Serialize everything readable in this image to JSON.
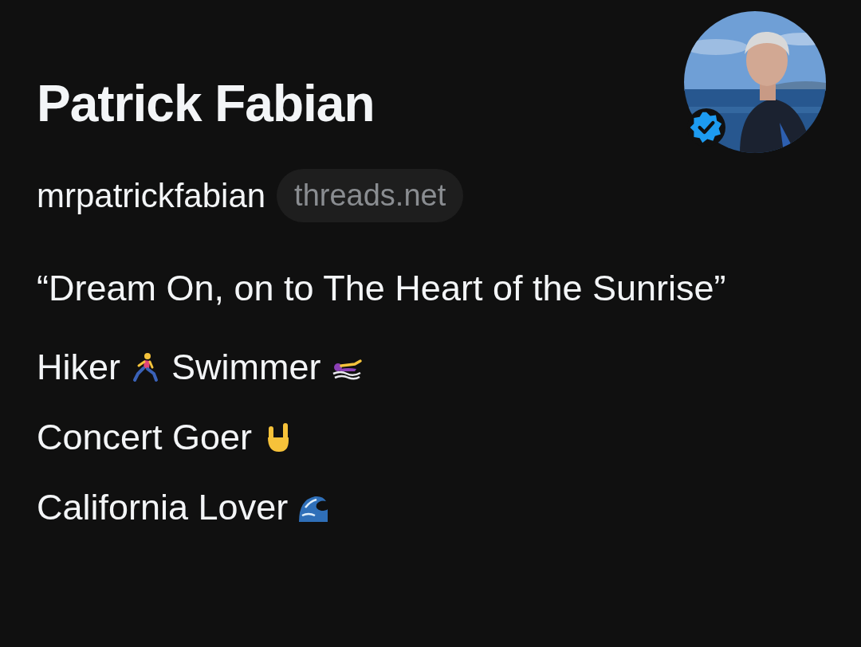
{
  "profile": {
    "name": "Patrick Fabian",
    "username": "mrpatrickfabian",
    "domain": "threads.net",
    "verified": true
  },
  "bio": [
    {
      "parts": [
        {
          "kind": "text",
          "text": "“Dream On, on to The Heart of the Sunrise”"
        }
      ]
    },
    {
      "parts": [
        {
          "kind": "text",
          "text": "Hiker"
        },
        {
          "kind": "runner"
        },
        {
          "kind": "text",
          "text": "Swimmer"
        },
        {
          "kind": "swimmer"
        }
      ]
    },
    {
      "parts": [
        {
          "kind": "text",
          "text": "Concert Goer"
        },
        {
          "kind": "horns"
        }
      ]
    },
    {
      "parts": [
        {
          "kind": "text",
          "text": "California Lover"
        },
        {
          "kind": "wave"
        }
      ]
    }
  ]
}
